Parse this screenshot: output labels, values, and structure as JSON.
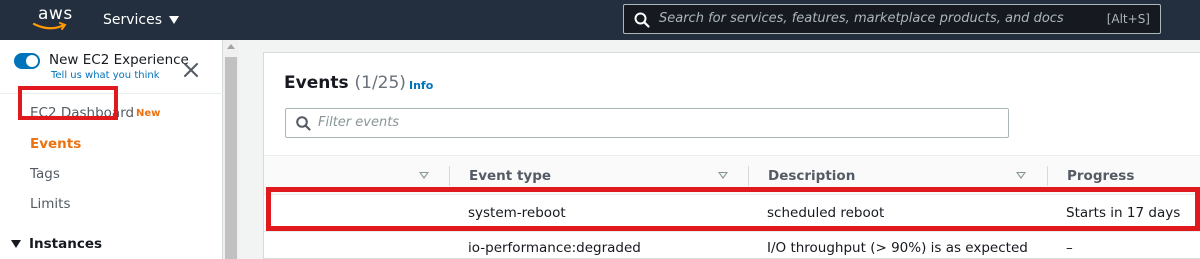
{
  "topbar": {
    "logo_text": "aws",
    "services_label": "Services",
    "search_placeholder": "Search for services, features, marketplace products, and docs",
    "search_shortcut": "[Alt+S]"
  },
  "sidebar": {
    "new_experience_label": "New EC2 Experience",
    "feedback_link": "Tell us what you think",
    "items": [
      {
        "label": "EC2 Dashboard",
        "badge": "New"
      },
      {
        "label": "Events",
        "active": true
      },
      {
        "label": "Tags"
      },
      {
        "label": "Limits"
      }
    ],
    "section": {
      "label": "Instances",
      "expanded": true
    }
  },
  "main": {
    "title": "Events",
    "count": "(1/25)",
    "info_link": "Info",
    "filter_placeholder": "Filter events",
    "columns": [
      "Event type",
      "Description",
      "Progress"
    ],
    "rows": [
      {
        "event_type": "system-reboot",
        "description": "scheduled reboot",
        "progress": "Starts in 17 days",
        "selected": true
      },
      {
        "event_type": "io-performance:degraded",
        "description": "I/O throughput (> 90%) is as expected",
        "progress": "–"
      }
    ]
  },
  "colors": {
    "nav_bg": "#232f3e",
    "accent_orange": "#ec7211",
    "link_blue": "#0073bb",
    "highlight_red": "#e0191d"
  },
  "icons": {
    "search": "search-icon",
    "close": "close-icon",
    "caret": "caret-down-icon",
    "sort": "sort-icon",
    "filter": "filter-search-icon"
  }
}
